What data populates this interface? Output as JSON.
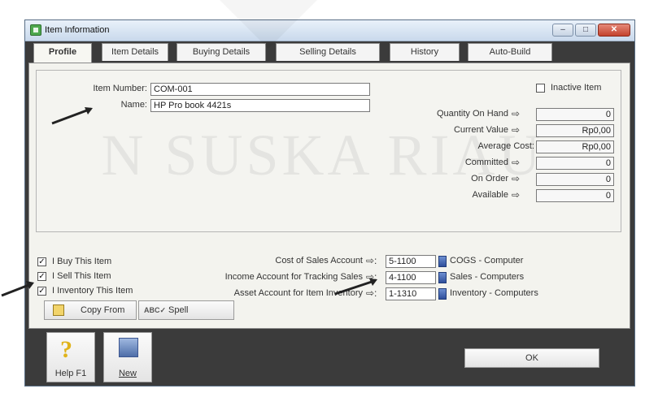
{
  "window": {
    "title": "Item Information"
  },
  "tabs": [
    "Profile",
    "Item Details",
    "Buying Details",
    "Selling Details",
    "History",
    "Auto-Build"
  ],
  "active_tab": "Profile",
  "profile": {
    "item_number_label": "Item Number:",
    "item_number": "COM-001",
    "name_label": "Name:",
    "name": "HP Pro book 4421s",
    "inactive_label": "Inactive Item",
    "inactive_checked": false,
    "stats": [
      {
        "label": "Quantity On Hand",
        "has_arrow": true,
        "value": "0"
      },
      {
        "label": "Current Value",
        "has_arrow": true,
        "value": "Rp0,00"
      },
      {
        "label": "Average Cost:",
        "has_arrow": false,
        "value": "Rp0,00"
      },
      {
        "label": "Committed",
        "has_arrow": true,
        "value": "0"
      },
      {
        "label": "On Order",
        "has_arrow": true,
        "value": "0"
      },
      {
        "label": "Available",
        "has_arrow": true,
        "value": "0"
      }
    ],
    "checks": [
      {
        "label": "I Buy This Item",
        "checked": true
      },
      {
        "label": "I Sell This Item",
        "checked": true
      },
      {
        "label": "I Inventory This Item",
        "checked": true
      }
    ],
    "accounts": [
      {
        "label": "Cost of Sales Account",
        "code": "5-1100",
        "name": "COGS - Computer"
      },
      {
        "label": "Income Account for Tracking Sales",
        "code": "4-1100",
        "name": "Sales - Computers"
      },
      {
        "label": "Asset Account for Item Inventory",
        "code": "1-1310",
        "name": "Inventory - Computers"
      }
    ]
  },
  "buttons": {
    "copy_from": "Copy From",
    "spell": "Spell",
    "help": "Help F1",
    "new": "New",
    "ok": "OK"
  },
  "watermark": "N SUSKA RIAU",
  "colors": {
    "accent_blue": "#2f4f9c",
    "titlebar": "#c9d9ec",
    "panel": "#f3f3ee",
    "footer": "#3b3b3b"
  }
}
